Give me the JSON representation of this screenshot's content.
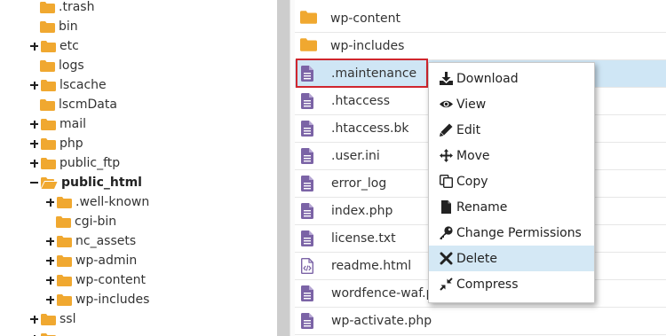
{
  "tree": {
    "items": [
      {
        "label": ".trash",
        "expander": "none",
        "open": false,
        "bold": false
      },
      {
        "label": "bin",
        "expander": "none",
        "open": false,
        "bold": false
      },
      {
        "label": "etc",
        "expander": "plus",
        "open": false,
        "bold": false
      },
      {
        "label": "logs",
        "expander": "none",
        "open": false,
        "bold": false
      },
      {
        "label": "lscache",
        "expander": "plus",
        "open": false,
        "bold": false
      },
      {
        "label": "lscmData",
        "expander": "none",
        "open": false,
        "bold": false
      },
      {
        "label": "mail",
        "expander": "plus",
        "open": false,
        "bold": false
      },
      {
        "label": "php",
        "expander": "plus",
        "open": false,
        "bold": false
      },
      {
        "label": "public_ftp",
        "expander": "plus",
        "open": false,
        "bold": false
      },
      {
        "label": "public_html",
        "expander": "minus",
        "open": true,
        "bold": true
      },
      {
        "label": ".well-known",
        "expander": "plus",
        "open": false,
        "bold": false
      },
      {
        "label": "cgi-bin",
        "expander": "none",
        "open": false,
        "bold": false
      },
      {
        "label": "nc_assets",
        "expander": "plus",
        "open": false,
        "bold": false
      },
      {
        "label": "wp-admin",
        "expander": "plus",
        "open": false,
        "bold": false
      },
      {
        "label": "wp-content",
        "expander": "plus",
        "open": false,
        "bold": false
      },
      {
        "label": "wp-includes",
        "expander": "plus",
        "open": false,
        "bold": false
      },
      {
        "label": "ssl",
        "expander": "plus",
        "open": false,
        "bold": false
      },
      {
        "label": "",
        "expander": "plus",
        "open": false,
        "bold": false
      }
    ]
  },
  "files": {
    "rows": [
      {
        "name": "wp-content",
        "icon": "folder-icon",
        "selected": false
      },
      {
        "name": "wp-includes",
        "icon": "folder-icon",
        "selected": false
      },
      {
        "name": ".maintenance",
        "icon": "text-file-icon",
        "selected": true
      },
      {
        "name": ".htaccess",
        "icon": "text-file-icon",
        "selected": false
      },
      {
        "name": ".htaccess.bk",
        "icon": "text-file-icon",
        "selected": false
      },
      {
        "name": ".user.ini",
        "icon": "text-file-icon",
        "selected": false
      },
      {
        "name": "error_log",
        "icon": "text-file-icon",
        "selected": false
      },
      {
        "name": "index.php",
        "icon": "text-file-icon",
        "selected": false
      },
      {
        "name": "license.txt",
        "icon": "text-file-icon",
        "selected": false
      },
      {
        "name": "readme.html",
        "icon": "code-file-icon",
        "selected": false
      },
      {
        "name": "wordfence-waf.php",
        "icon": "text-file-icon",
        "selected": false
      },
      {
        "name": "wp-activate.php",
        "icon": "text-file-icon",
        "selected": false
      }
    ]
  },
  "context_menu": {
    "items": [
      {
        "label": "Download",
        "icon": "download-icon",
        "active": false
      },
      {
        "label": "View",
        "icon": "eye-icon",
        "active": false
      },
      {
        "label": "Edit",
        "icon": "pencil-icon",
        "active": false
      },
      {
        "label": "Move",
        "icon": "move-arrows-icon",
        "active": false
      },
      {
        "label": "Copy",
        "icon": "copy-icon",
        "active": false
      },
      {
        "label": "Rename",
        "icon": "file-icon",
        "active": false
      },
      {
        "label": "Change Permissions",
        "icon": "key-icon",
        "active": false
      },
      {
        "label": "Delete",
        "icon": "close-x-icon",
        "active": true
      },
      {
        "label": "Compress",
        "icon": "compress-icon",
        "active": false
      }
    ]
  },
  "colors": {
    "folder": "#f0a830",
    "file_icon": "#7b63a6",
    "selected_row": "#cfe6f5",
    "highlight_border": "#d0262e",
    "menu_active": "#d4e8f5"
  }
}
